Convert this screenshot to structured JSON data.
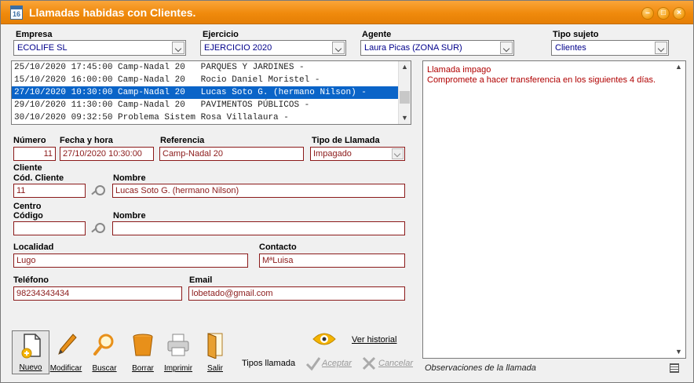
{
  "window": {
    "title": "Llamadas habidas con Clientes.",
    "icon_text": "16"
  },
  "filters": {
    "empresa": {
      "label": "Empresa",
      "value": "ECOLIFE SL"
    },
    "ejercicio": {
      "label": "Ejercicio",
      "value": "EJERCICIO 2020"
    },
    "agente": {
      "label": "Agente",
      "value": "Laura Picas (ZONA SUR)"
    },
    "tipo_sujeto": {
      "label": "Tipo sujeto",
      "value": "Clientes"
    }
  },
  "calls": [
    {
      "text": "25/10/2020 17:45:00 Camp-Nadal 20   PARQUES Y JARDINES -",
      "selected": false
    },
    {
      "text": "15/10/2020 16:00:00 Camp-Nadal 20   Rocio Daniel Moristel -",
      "selected": false
    },
    {
      "text": "27/10/2020 10:30:00 Camp-Nadal 20   Lucas Soto G. (hermano Nilson) -",
      "selected": true
    },
    {
      "text": "29/10/2020 11:30:00 Camp-Nadal 20   PAVIMENTOS PÚBLICOS -",
      "selected": false
    },
    {
      "text": "30/10/2020 09:32:50 Problema Sistem Rosa Villalaura -",
      "selected": false
    }
  ],
  "form": {
    "numero": {
      "label": "Número",
      "value": "11"
    },
    "fecha": {
      "label": "Fecha y hora",
      "value": "27/10/2020 10:30:00"
    },
    "referencia": {
      "label": "Referencia",
      "value": "Camp-Nadal 20"
    },
    "tipo_llamada": {
      "label": "Tipo de Llamada",
      "value": "Impagado"
    },
    "cliente_section": "Cliente",
    "cod_cliente": {
      "label": "Cód. Cliente",
      "value": "11"
    },
    "nombre_cliente": {
      "label": "Nombre",
      "value": "Lucas Soto G. (hermano Nilson)"
    },
    "centro_section": "Centro",
    "codigo_centro": {
      "label": "Código",
      "value": ""
    },
    "nombre_centro": {
      "label": "Nombre",
      "value": ""
    },
    "localidad": {
      "label": "Localidad",
      "value": "Lugo"
    },
    "contacto": {
      "label": "Contacto",
      "value": "MªLuisa"
    },
    "telefono": {
      "label": "Teléfono",
      "value": "98234343434"
    },
    "email": {
      "label": "Email",
      "value": "lobetado@gmail.com"
    }
  },
  "observations": {
    "lines": [
      "Llamada impago",
      "Compromete a hacer transferencia en los siguientes 4 días."
    ],
    "caption": "Observaciones de la llamada"
  },
  "toolbar": {
    "nuevo": "Nuevo",
    "modificar": "Modificar",
    "buscar": "Buscar",
    "borrar": "Borrar",
    "imprimir": "Imprimir",
    "salir": "Salir",
    "tipos_llamada": "Tipos llamada",
    "ver_historial": "Ver historial",
    "aceptar": "Aceptar",
    "cancelar": "Cancelar"
  },
  "colors": {
    "titlebar": "#f08a0c",
    "field_border": "#8b1a1a",
    "field_text": "#8b1a1a",
    "selection": "#0a64c8",
    "observation_text": "#b00000"
  }
}
